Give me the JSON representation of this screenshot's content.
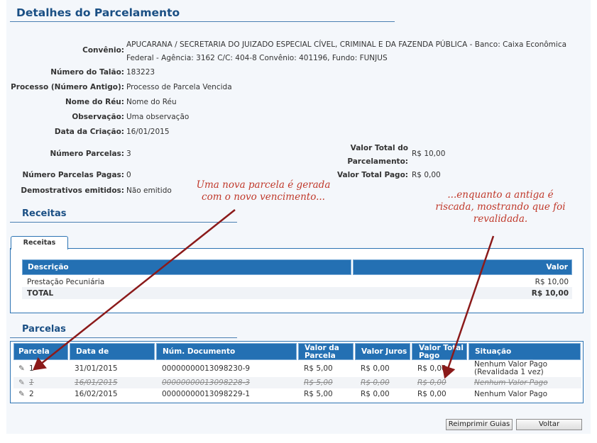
{
  "header": {
    "title": "Detalhes do Parcelamento"
  },
  "details": {
    "convenio_label": "Convênio:",
    "convenio_line1": "APUCARANA / SECRETARIA DO JUIZADO ESPECIAL CÍVEL, CRIMINAL E DA FAZENDA PÚBLICA - Banco: Caixa Econômica",
    "convenio_line2": "Federal - Agência: 3162 C/C: 404-8 Convênio: 401196, Fundo: FUNJUS",
    "talao_label": "Número do Talão:",
    "talao_value": "183223",
    "processo_label": "Processo (Número Antigo):",
    "processo_value": "Processo de Parcela Vencida",
    "reu_label": "Nome do Réu:",
    "reu_value": "Nome do Réu",
    "obs_label": "Observação:",
    "obs_value": "Uma observação",
    "criacao_label": "Data da Criação:",
    "criacao_value": "16/01/2015",
    "num_parcelas_label": "Número Parcelas:",
    "num_parcelas_value": "3",
    "valor_total_label_1": "Valor Total do",
    "valor_total_label_2": "Parcelamento:",
    "valor_total_value": "R$ 10,00",
    "pagas_label": "Número Parcelas Pagas:",
    "pagas_value": "0",
    "valor_pago_label": "Valor Total Pago:",
    "valor_pago_value": "R$ 0,00",
    "demonstrativos_label": "Demostrativos emitidos:",
    "demonstrativos_value": "Não emitido"
  },
  "receitas": {
    "section_title": "Receitas",
    "tab_label": "Receitas",
    "col_descricao": "Descrição",
    "col_valor": "Valor",
    "rows": [
      {
        "descricao": "Prestação Pecuniária",
        "valor": "R$ 10,00"
      }
    ],
    "total_label": "TOTAL",
    "total_value": "R$ 10,00"
  },
  "parcelas": {
    "section_title": "Parcelas",
    "columns": {
      "parcela": "Parcela",
      "vencimento": "Data de Vencimento",
      "documento": "Núm. Documento",
      "valor_parcela_1": "Valor da",
      "valor_parcela_2": "Parcela",
      "juros": "Valor Juros",
      "total_pago_1": "Valor Total",
      "total_pago_2": "Pago",
      "situacao": "Situação"
    },
    "rows": [
      {
        "parcela": "1",
        "vencimento": "31/01/2015",
        "documento": "00000000013098230-9",
        "valor": "R$ 5,00",
        "juros": "R$ 0,00",
        "pago": "R$ 0,00",
        "situacao_1": "Nenhum Valor Pago",
        "situacao_2": "(Revalidada 1 vez)"
      },
      {
        "parcela": "1",
        "vencimento": "16/01/2015",
        "documento": "00000000013098228-3",
        "valor": "R$ 5,00",
        "juros": "R$ 0,00",
        "pago": "R$ 0,00",
        "situacao_1": "Nenhum Valor Pago"
      },
      {
        "parcela": "2",
        "vencimento": "16/02/2015",
        "documento": "00000000013098229-1",
        "valor": "R$ 5,00",
        "juros": "R$ 0,00",
        "pago": "R$ 0,00",
        "situacao_1": "Nenhum Valor Pago"
      }
    ]
  },
  "buttons": {
    "reprint": "Reimprimir Guias",
    "back": "Voltar"
  },
  "annotations": {
    "left_1": "Uma nova parcela é gerada",
    "left_2": "com o novo vencimento...",
    "right_1": "...enquanto a antiga é",
    "right_2": "riscada, mostrando que foi",
    "right_3": "revalidada."
  },
  "colors": {
    "accent": "#1a4f84",
    "header_bg": "#2470b3",
    "annotation": "#c0392b",
    "arrow": "#8b1a1a"
  },
  "icons": {
    "edit": "pencil-icon"
  }
}
